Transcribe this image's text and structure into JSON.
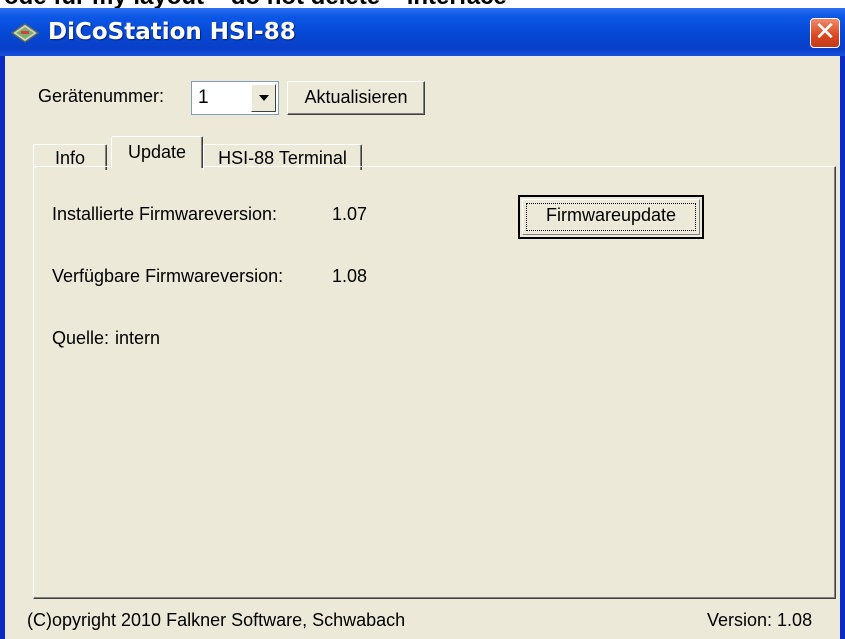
{
  "window": {
    "title": "DiCoStation HSI-88",
    "close_glyph": "✕",
    "app_icon": "monitor-icon",
    "top_caption": "ode für my layout – do not delete – interface"
  },
  "device": {
    "label": "Gerätenummer:",
    "value": "1",
    "refresh_label": "Aktualisieren"
  },
  "tabs": [
    {
      "label": "Info",
      "active": false
    },
    {
      "label": "Update",
      "active": true
    },
    {
      "label": "HSI-88 Terminal",
      "active": false
    }
  ],
  "update": {
    "installed_label": "Installierte Firmwareversion:",
    "installed_value": "1.07",
    "available_label": "Verfügbare Firmwareversion:",
    "available_value": "1.08",
    "source_label": "Quelle:",
    "source_value": "intern",
    "update_button": "Firmwareupdate"
  },
  "footer": {
    "copyright": "(C)opyright 2010 Falkner Software, Schwabach",
    "version": "Version: 1.08"
  },
  "colors": {
    "titlebar": "#0548d4",
    "client": "#ece9d8",
    "close": "#d9461f"
  }
}
